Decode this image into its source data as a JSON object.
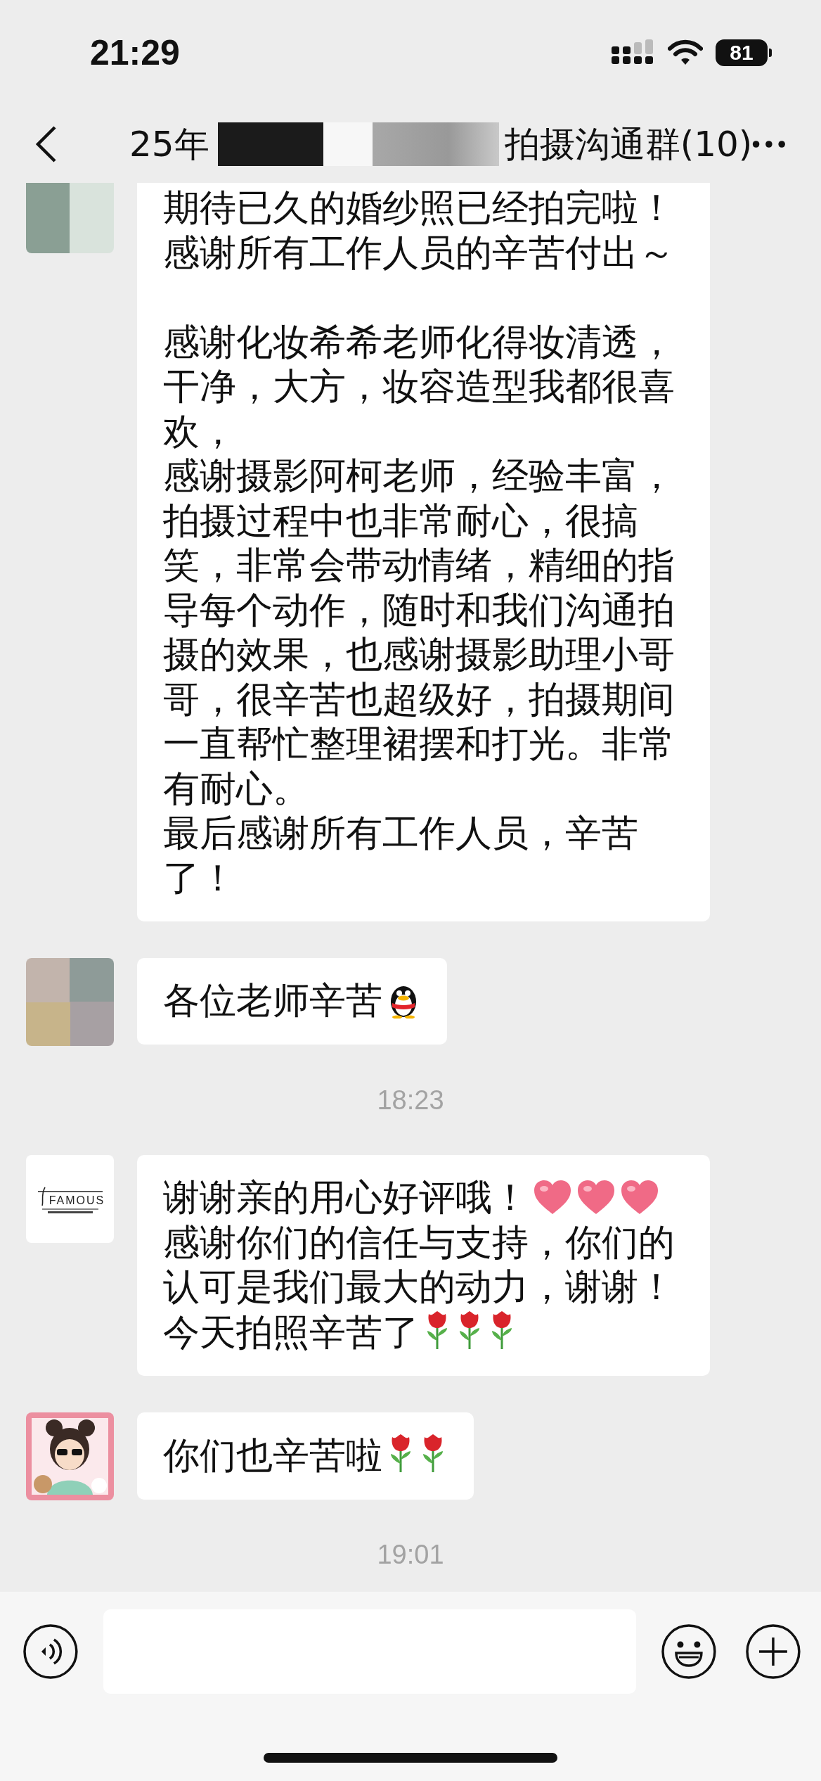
{
  "status_bar": {
    "time": "21:29",
    "battery": "81"
  },
  "nav": {
    "title_start": "25年",
    "title_end": "拍摄沟通群(10)",
    "title_redacted": true
  },
  "chat": [
    {
      "kind": "message",
      "avatar": {
        "kind": "photo"
      },
      "paragraphs": [
        {
          "kind": "line",
          "parts": [
            {
              "kind": "text",
              "text": "期待已久的婚纱照已经拍完啦！"
            }
          ]
        },
        {
          "kind": "line",
          "parts": [
            {
              "kind": "text",
              "text": "感谢所有工作人员的辛苦付出～"
            }
          ]
        },
        {
          "kind": "blank"
        },
        {
          "kind": "line",
          "parts": [
            {
              "kind": "text",
              "text": "感谢化妆希希老师化得妆清透，干净，大方，妆容造型我都很喜欢，"
            }
          ]
        },
        {
          "kind": "line",
          "parts": [
            {
              "kind": "text",
              "text": "感谢摄影阿柯老师，经验丰富，拍摄过程中也非常耐心，很搞笑，非常会带动情绪，精细的指导每个动作，随时和我们沟通拍摄的效果，也感谢摄影助理小哥哥，很辛苦也超级好，拍摄期间一直帮忙整理裙摆和打光。非常有耐心。"
            }
          ]
        },
        {
          "kind": "line",
          "parts": [
            {
              "kind": "text",
              "text": "最后感谢所有工作人员，辛苦了！"
            }
          ]
        }
      ]
    },
    {
      "kind": "message",
      "avatar": {
        "kind": "photo"
      },
      "paragraphs": [
        {
          "kind": "line",
          "parts": [
            {
              "kind": "text",
              "text": "各位老师辛苦"
            },
            {
              "kind": "penguin"
            }
          ]
        }
      ]
    },
    {
      "kind": "time",
      "text": "18:23"
    },
    {
      "kind": "message",
      "avatar": {
        "kind": "logo",
        "text": "FAMOUS"
      },
      "paragraphs": [
        {
          "kind": "line",
          "parts": [
            {
              "kind": "text",
              "text": "谢谢亲的用心好评哦！"
            },
            {
              "kind": "heart"
            },
            {
              "kind": "heart"
            },
            {
              "kind": "heart"
            }
          ]
        },
        {
          "kind": "line",
          "parts": [
            {
              "kind": "text",
              "text": "感谢你们的信任与支持，你们的认可是我们最大的动力，谢谢！"
            }
          ]
        },
        {
          "kind": "line",
          "parts": [
            {
              "kind": "text",
              "text": "今天拍照辛苦了"
            },
            {
              "kind": "rose"
            },
            {
              "kind": "rose"
            },
            {
              "kind": "rose"
            }
          ]
        }
      ]
    },
    {
      "kind": "message",
      "avatar": {
        "kind": "cartoon"
      },
      "paragraphs": [
        {
          "kind": "line",
          "parts": [
            {
              "kind": "text",
              "text": "你们也辛苦啦"
            },
            {
              "kind": "rose"
            },
            {
              "kind": "rose"
            }
          ]
        }
      ]
    },
    {
      "kind": "time",
      "text": "19:01"
    }
  ]
}
